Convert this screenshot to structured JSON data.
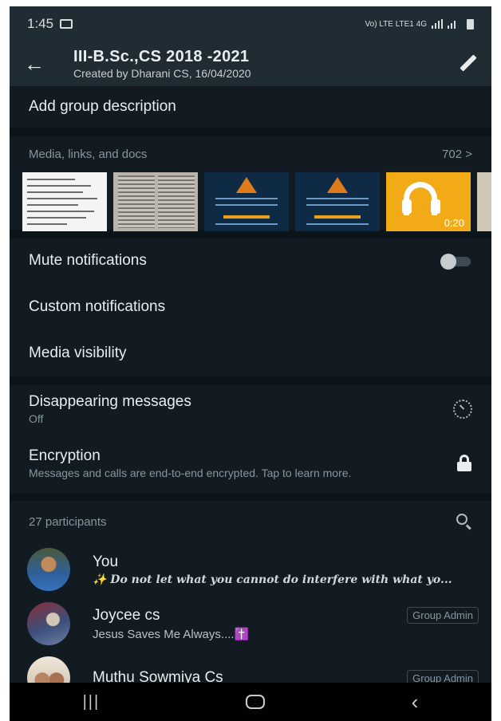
{
  "status_bar": {
    "time": "1:45",
    "network_text": "Vo) LTE LTE1 4G"
  },
  "header": {
    "title": "III-B.Sc.,CS 2018 -2021",
    "subtitle": "Created by Dharani CS, 16/04/2020"
  },
  "description": {
    "label": "Add group description"
  },
  "media": {
    "label": "Media, links, and docs",
    "count": "702 >",
    "audio_duration": "0:20"
  },
  "settings": {
    "mute": {
      "label": "Mute notifications",
      "on": false
    },
    "custom": {
      "label": "Custom notifications"
    },
    "visibility": {
      "label": "Media visibility"
    }
  },
  "disappearing": {
    "label": "Disappearing messages",
    "value": "Off"
  },
  "encryption": {
    "label": "Encryption",
    "detail": "Messages and calls are end-to-end encrypted. Tap to learn more."
  },
  "participants": {
    "header": "27 participants",
    "items": [
      {
        "name": "You",
        "status": "✨ Do not let what you cannot do interfere with what yo...",
        "badge": ""
      },
      {
        "name": "Joycee cs",
        "status": "Jesus Saves Me Always....✝️",
        "badge": "Group Admin"
      },
      {
        "name": "Muthu Sowmiya Cs",
        "status": "",
        "badge": "Group Admin"
      }
    ]
  },
  "icons": {
    "back": "arrow-left-icon",
    "edit": "pencil-icon",
    "timer": "timer-icon",
    "lock": "lock-icon",
    "search": "search-icon"
  },
  "colors": {
    "background": "#111b21",
    "bar": "#1f2c34",
    "secondary_text": "#8696a0",
    "audio_thumb": "#f2ab17"
  }
}
